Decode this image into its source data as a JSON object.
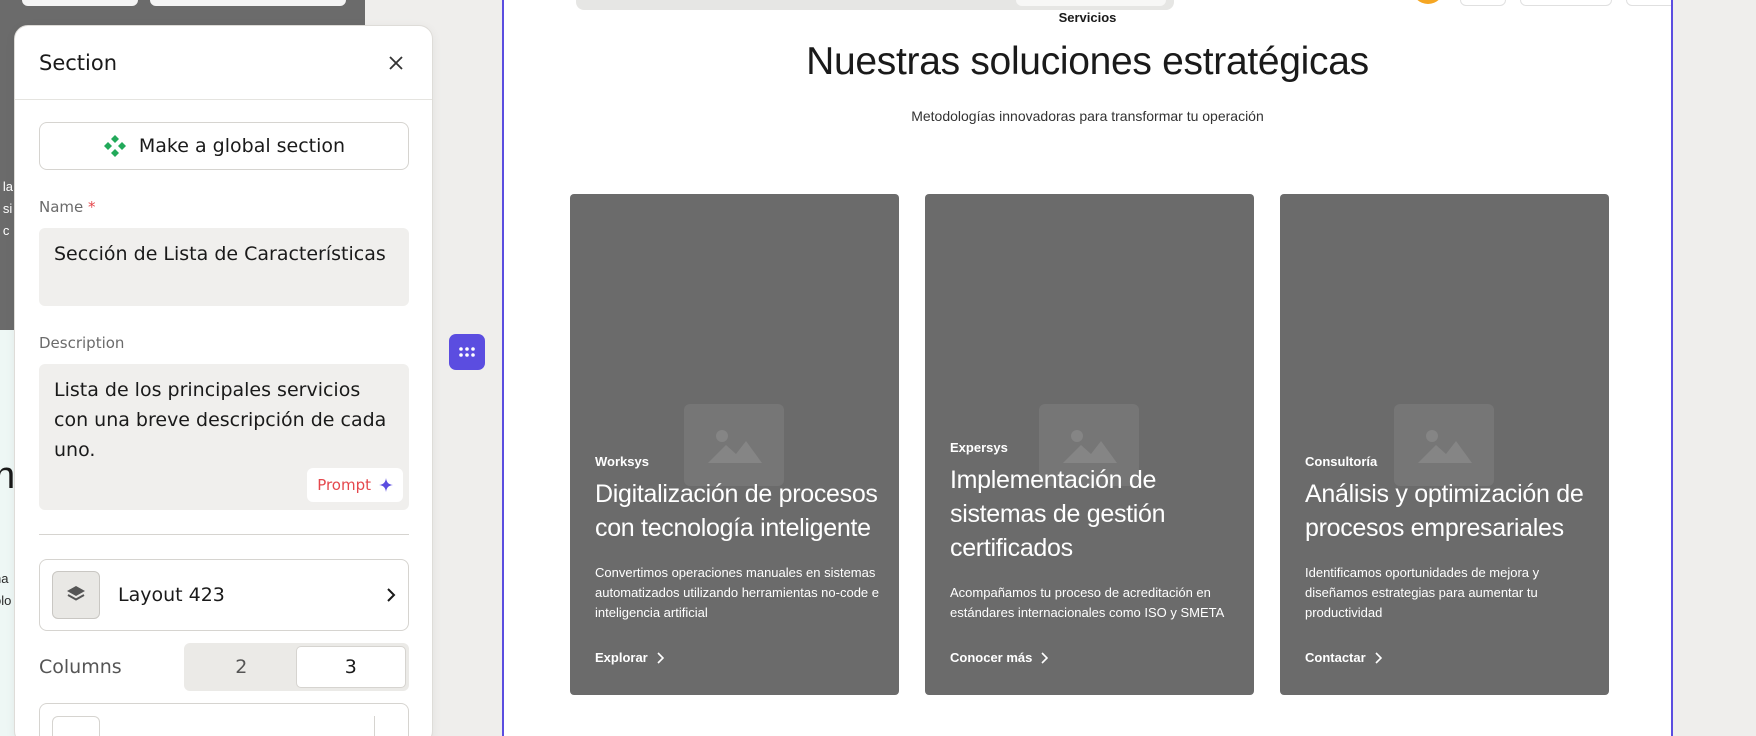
{
  "panel": {
    "title": "Section",
    "global_section_button": "Make a global section",
    "name_label": "Name",
    "name_required_mark": "*",
    "name_value": "Sección de Lista de Características",
    "description_label": "Description",
    "description_value": "Lista de los principales servicios con una breve descripción de cada uno.",
    "prompt_button": "Prompt",
    "layout_label": "Layout 423",
    "columns_label": "Columns",
    "column_options": [
      "2",
      "3"
    ],
    "columns_selected": "3"
  },
  "canvas": {
    "tagline": "Servicios",
    "heading": "Nuestras soluciones estratégicas",
    "subheading": "Metodologías innovadoras para transformar tu operación",
    "cards": [
      {
        "eyebrow": "Worksys",
        "title": "Digitalización de procesos con tecnología inteligente",
        "description": "Convertimos operaciones manuales en sistemas automatizados utilizando herramientas no-code e inteligencia artificial",
        "link": "Explorar"
      },
      {
        "eyebrow": "Expersys",
        "title": "Implementación de sistemas de gestión certificados",
        "description": "Acompañamos tu proceso de acreditación en estándares internacionales como ISO y SMETA",
        "link": "Conocer más"
      },
      {
        "eyebrow": "Consultoría",
        "title": "Análisis y optimización de procesos empresariales",
        "description": "Identificamos oportunidades de mejora y diseñamos estrategias para aumentar tu productividad",
        "link": "Contactar"
      }
    ]
  },
  "background_fragments": {
    "line_a": "a la",
    "line_b": "e si",
    "line_c": "o c",
    "big_letter": "n",
    "line_d": "na",
    "line_e": "olo"
  },
  "colors": {
    "accent": "#5b4de0",
    "card_bg": "#6b6b6b",
    "required": "#e5484d",
    "global_icon": "#22a95a"
  },
  "icons": {
    "close": "close-icon",
    "global": "global-component-icon",
    "prompt": "sparkle-icon",
    "layout": "layers-icon",
    "chevron": "chevron-right-icon",
    "grab": "grid-dots-icon",
    "image_placeholder": "image-placeholder-icon"
  }
}
